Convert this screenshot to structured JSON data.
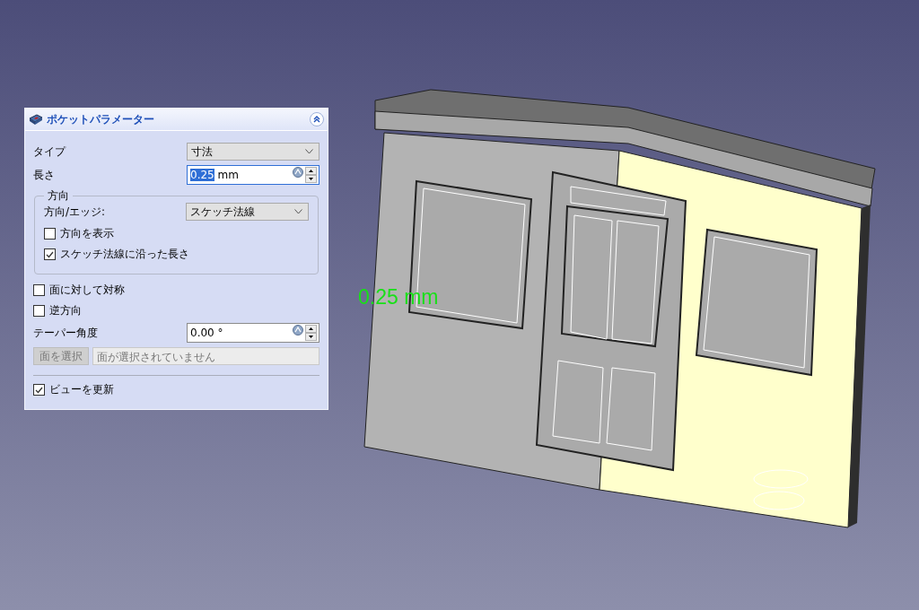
{
  "panel": {
    "title": "ポケットパラメーター",
    "type": {
      "label": "タイプ",
      "value": "寸法"
    },
    "length": {
      "label": "長さ",
      "value": "0.25",
      "unit": "mm",
      "value_selected": true
    },
    "direction": {
      "title": "方向",
      "label": "方向/エッジ:",
      "value": "スケッチ法線",
      "options": [
        {
          "label": "方向を表示",
          "checked": false
        },
        {
          "label": "スケッチ法線に沿った長さ",
          "checked": true
        }
      ]
    },
    "options": [
      {
        "label": "面に対して対称",
        "checked": false
      },
      {
        "label": "逆方向",
        "checked": false
      }
    ],
    "taper": {
      "label": "テーパー角度",
      "value": "0.00 °"
    },
    "select_face": {
      "button": "面を選択",
      "disabled": true,
      "value": "面が選択されていません"
    },
    "update_view": {
      "label": "ビューを更新",
      "checked": true
    }
  },
  "viewport": {
    "dimension_label": "0.25 mm"
  }
}
